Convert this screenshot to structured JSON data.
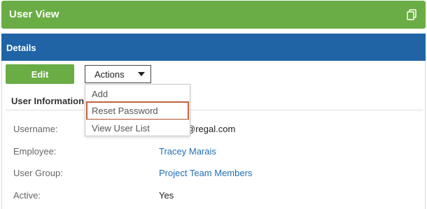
{
  "header": {
    "title": "User View",
    "icon": "copy-icon"
  },
  "details": {
    "label": "Details"
  },
  "toolbar": {
    "edit_label": "Edit",
    "actions_label": "Actions"
  },
  "actions_menu": {
    "items": [
      {
        "label": "Add"
      },
      {
        "label": "Reset Password",
        "highlighted": true
      },
      {
        "label": "View User List"
      }
    ]
  },
  "user_info": {
    "heading": "User Information",
    "rows": [
      {
        "label": "Username:",
        "value": "marais@regal.com"
      },
      {
        "label": "Employee:",
        "value": "Tracey Marais"
      },
      {
        "label": "User Group:",
        "value": "Project Team Members"
      },
      {
        "label": "Active:",
        "value": "Yes"
      }
    ]
  },
  "colors": {
    "header_green": "#6aad45",
    "details_blue": "#2064a6",
    "link_blue": "#1f6fb5",
    "highlight_border": "#c2623f"
  }
}
